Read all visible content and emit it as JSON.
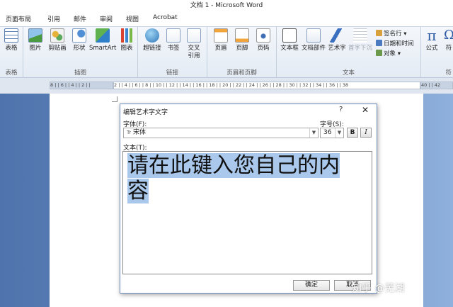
{
  "window": {
    "title": "文档 1 - Microsoft Word"
  },
  "ribbon_tabs": [
    "页面布局",
    "引用",
    "邮件",
    "审阅",
    "视图",
    "Acrobat"
  ],
  "ribbon": {
    "groups": [
      {
        "label": "表格",
        "buttons": [
          "表格"
        ]
      },
      {
        "label": "插图",
        "buttons": [
          "图片",
          "剪贴画",
          "形状",
          "SmartArt",
          "图表"
        ]
      },
      {
        "label": "链接",
        "buttons": [
          "超链接",
          "书签",
          "交叉",
          "引用"
        ]
      },
      {
        "label": "页眉和页脚",
        "buttons": [
          "页眉",
          "页脚",
          "页码"
        ]
      },
      {
        "label": "文本",
        "buttons": [
          "文本框",
          "文档部件",
          "艺术字",
          "首字下沉"
        ],
        "small_buttons": [
          "签名行",
          "日期和时间",
          "对象"
        ]
      },
      {
        "label": "符",
        "buttons": [
          "公式",
          "符"
        ]
      }
    ]
  },
  "ruler": {
    "left_text": "8 | | 6 | | 4 | | 2 | |",
    "main_text": "2 | | 4 | | 6 | | 8 | | 10 | | 12 | | 14 | | 16 | | 18 | | 20 | | 22 | | 24 | | 26 | | 28 | | 30 | | 32 | | 34 | | 36 | | 38",
    "right_text": "40 | | 42"
  },
  "dialog": {
    "title": "编辑艺术字文字",
    "help": "?",
    "close": "✕",
    "font_label": "字体(F):",
    "font_value": "宋体",
    "font_prefix": "Tr",
    "size_label": "字号(S):",
    "size_value": "36",
    "bold_label": "B",
    "italic_label": "I",
    "text_label": "文本(T):",
    "text_line1": "请在此键入您自己的内",
    "text_line2": "容",
    "ok": "确定",
    "cancel": "取消"
  },
  "watermark": "知乎 @芜湖"
}
